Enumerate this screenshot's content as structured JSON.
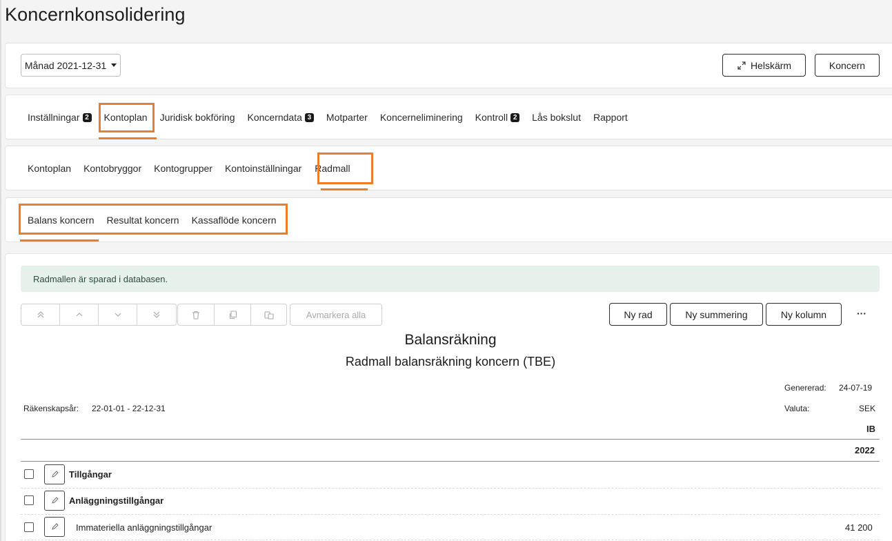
{
  "page_title": "Koncernkonsolidering",
  "header": {
    "period_select": "Månad 2021-12-31",
    "fullscreen_label": "Helskärm",
    "group_label": "Koncern"
  },
  "main_tabs": [
    {
      "label": "Inställningar",
      "badge": "2"
    },
    {
      "label": "Kontoplan",
      "active": true
    },
    {
      "label": "Juridisk bokföring"
    },
    {
      "label": "Koncerndata",
      "badge": "3"
    },
    {
      "label": "Motparter"
    },
    {
      "label": "Koncerneliminering"
    },
    {
      "label": "Kontroll",
      "badge": "2"
    },
    {
      "label": "Lås bokslut"
    },
    {
      "label": "Rapport"
    }
  ],
  "sub_tabs": [
    {
      "label": "Kontoplan"
    },
    {
      "label": "Kontobryggor"
    },
    {
      "label": "Kontogrupper"
    },
    {
      "label": "Kontoinställningar"
    },
    {
      "label": "Radmall",
      "active": true
    }
  ],
  "report_tabs": [
    {
      "label": "Balans koncern",
      "active": true
    },
    {
      "label": "Resultat koncern"
    },
    {
      "label": "Kassaflöde koncern"
    }
  ],
  "success_message": "Radmallen är sparad i databasen.",
  "toolbar": {
    "move_icons": [
      "double-chevron-up-icon",
      "chevron-up-icon",
      "chevron-down-icon",
      "double-chevron-down-icon"
    ],
    "action_icons": [
      "trash-icon",
      "copy-icon",
      "paste-icon"
    ],
    "deselect_all": "Avmarkera alla",
    "new_row": "Ny rad",
    "new_sum": "Ny summering",
    "new_column": "Ny kolumn",
    "more": "···"
  },
  "report": {
    "title": "Balansräkning",
    "subtitle": "Radmall balansräkning koncern (TBE)",
    "generated_label": "Genererad:",
    "generated_value": "24-07-19",
    "currency_label": "Valuta:",
    "currency_value": "SEK",
    "fiscal_year_label": "Räkenskapsår:",
    "fiscal_year_value": "22-01-01 - 22-12-31",
    "col_header_type": "IB",
    "col_header_year": "2022"
  },
  "rows": [
    {
      "label": "Tillgångar",
      "bold": true,
      "value": ""
    },
    {
      "label": "Anläggningstillgångar",
      "bold": true,
      "value": ""
    },
    {
      "label": "Immateriella anläggningstillgångar",
      "bold": false,
      "value": "41 200"
    }
  ],
  "colors": {
    "accent": "#ed7d2b",
    "success_bg": "#e7f1ec",
    "badge": "#1a1a1a"
  }
}
